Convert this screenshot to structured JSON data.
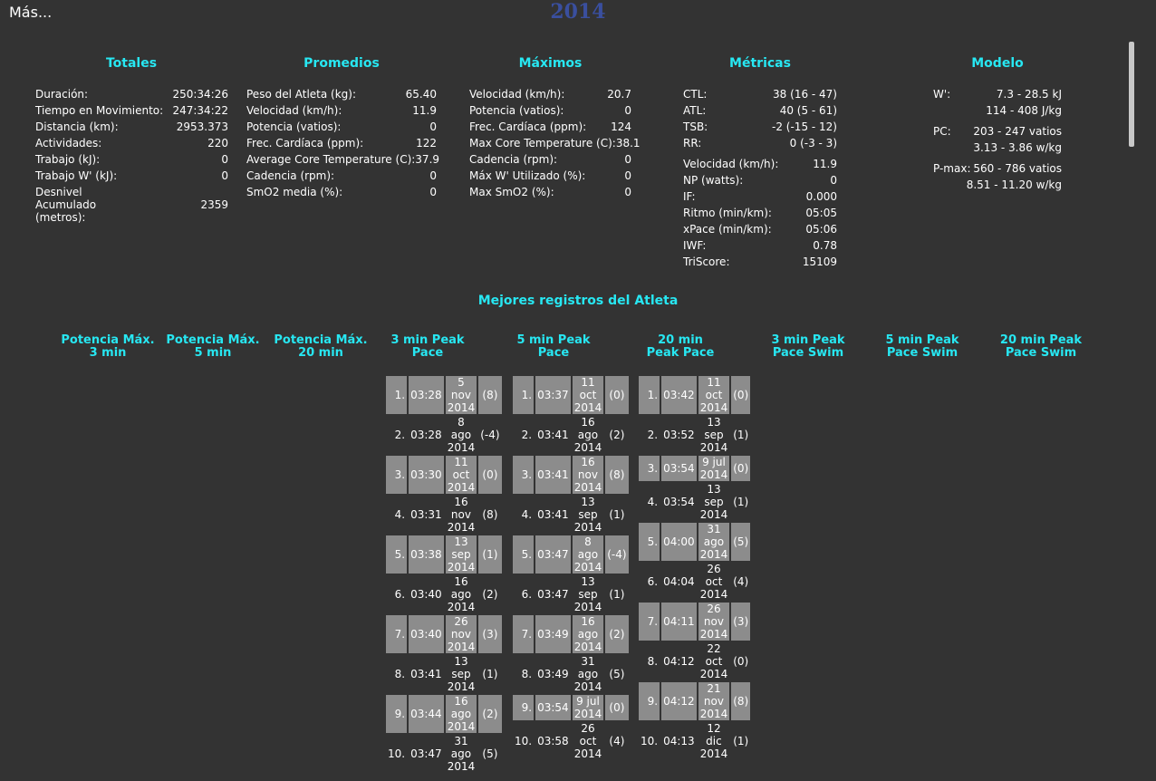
{
  "header": {
    "more_label": "Más...",
    "year": "2014"
  },
  "totales": {
    "title": "Totales",
    "rows": [
      {
        "label": "Duración:",
        "value": "250:34:26"
      },
      {
        "label": "Tiempo en Movimiento:",
        "value": "247:34:22"
      },
      {
        "label": "Distancia (km):",
        "value": "2953.373"
      },
      {
        "label": "Actividades:",
        "value": "220"
      },
      {
        "label": "Trabajo (kJ):",
        "value": "0"
      },
      {
        "label": "Trabajo W' (kJ):",
        "value": "0"
      },
      {
        "label": "Desnivel Acumulado (metros):",
        "value": "2359"
      }
    ]
  },
  "promedios": {
    "title": "Promedios",
    "rows": [
      {
        "label": "Peso del Atleta (kg):",
        "value": "65.40"
      },
      {
        "label": "Velocidad (km/h):",
        "value": "11.9"
      },
      {
        "label": "Potencia (vatios):",
        "value": "0"
      },
      {
        "label": "Frec. Cardíaca (ppm):",
        "value": "122"
      },
      {
        "label": "Average Core Temperature (C):",
        "value": "37.9"
      },
      {
        "label": "Cadencia (rpm):",
        "value": "0"
      },
      {
        "label": "SmO2 media (%):",
        "value": "0"
      }
    ]
  },
  "maximos": {
    "title": "Máximos",
    "rows": [
      {
        "label": "Velocidad (km/h):",
        "value": "20.7"
      },
      {
        "label": "Potencia (vatios):",
        "value": "0"
      },
      {
        "label": "Frec. Cardíaca (ppm):",
        "value": "124"
      },
      {
        "label": "Max Core Temperature (C):",
        "value": "38.1"
      },
      {
        "label": "Cadencia (rpm):",
        "value": "0"
      },
      {
        "label": "Máx W' Utilizado (%):",
        "value": "0"
      },
      {
        "label": "Max SmO2 (%):",
        "value": "0"
      }
    ]
  },
  "metricas": {
    "title": "Métricas",
    "group1": [
      {
        "label": "CTL:",
        "value": "38 (16 - 47)"
      },
      {
        "label": "ATL:",
        "value": "40 (5 - 61)"
      },
      {
        "label": "TSB:",
        "value": "-2 (-15 - 12)"
      },
      {
        "label": "RR:",
        "value": "0 (-3 - 3)"
      }
    ],
    "group2": [
      {
        "label": "Velocidad (km/h):",
        "value": "11.9"
      },
      {
        "label": "NP (watts):",
        "value": "0"
      },
      {
        "label": "IF:",
        "value": "0.000"
      },
      {
        "label": "Ritmo (min/km):",
        "value": "05:05"
      },
      {
        "label": "xPace (min/km):",
        "value": "05:06"
      },
      {
        "label": "IWF:",
        "value": "0.78"
      },
      {
        "label": "TriScore:",
        "value": "15109"
      }
    ]
  },
  "modelo": {
    "title": "Modelo",
    "rows": [
      {
        "label": "W':",
        "value1": "7.3 - 28.5 kJ",
        "value2": "114 - 408 J/kg"
      },
      {
        "label": "PC:",
        "value1": "203 - 247 vatios",
        "value2": "3.13 - 3.86 w/kg"
      },
      {
        "label": "P-max:",
        "value1": "560 - 786 vatios",
        "value2": "8.51 - 11.20 w/kg"
      }
    ]
  },
  "records": {
    "title": "Mejores registros del Atleta",
    "columns": [
      "Potencia Máx. 3 min",
      "Potencia Máx. 5 min",
      "Potencia Máx. 20 min",
      "3 min Peak Pace",
      "5 min Peak Pace",
      "20 min Peak Pace",
      "3 min Peak Pace Swim",
      "5 min Peak Pace Swim",
      "20 min Peak Pace Swim"
    ],
    "pace3": [
      {
        "rank": "1.",
        "time": "03:28",
        "date": "5 nov 2014",
        "delta": "(8)"
      },
      {
        "rank": "2.",
        "time": "03:28",
        "date": "8 ago 2014",
        "delta": "(-4)"
      },
      {
        "rank": "3.",
        "time": "03:30",
        "date": "11 oct 2014",
        "delta": "(0)"
      },
      {
        "rank": "4.",
        "time": "03:31",
        "date": "16 nov 2014",
        "delta": "(8)"
      },
      {
        "rank": "5.",
        "time": "03:38",
        "date": "13 sep 2014",
        "delta": "(1)"
      },
      {
        "rank": "6.",
        "time": "03:40",
        "date": "16 ago 2014",
        "delta": "(2)"
      },
      {
        "rank": "7.",
        "time": "03:40",
        "date": "26 nov 2014",
        "delta": "(3)"
      },
      {
        "rank": "8.",
        "time": "03:41",
        "date": "13 sep 2014",
        "delta": "(1)"
      },
      {
        "rank": "9.",
        "time": "03:44",
        "date": "16 ago 2014",
        "delta": "(2)"
      },
      {
        "rank": "10.",
        "time": "03:47",
        "date": "31 ago 2014",
        "delta": "(5)"
      }
    ],
    "pace5": [
      {
        "rank": "1.",
        "time": "03:37",
        "date": "11 oct 2014",
        "delta": "(0)"
      },
      {
        "rank": "2.",
        "time": "03:41",
        "date": "16 ago 2014",
        "delta": "(2)"
      },
      {
        "rank": "3.",
        "time": "03:41",
        "date": "16 nov 2014",
        "delta": "(8)"
      },
      {
        "rank": "4.",
        "time": "03:41",
        "date": "13 sep 2014",
        "delta": "(1)"
      },
      {
        "rank": "5.",
        "time": "03:47",
        "date": "8 ago 2014",
        "delta": "(-4)"
      },
      {
        "rank": "6.",
        "time": "03:47",
        "date": "13 sep 2014",
        "delta": "(1)"
      },
      {
        "rank": "7.",
        "time": "03:49",
        "date": "16 ago 2014",
        "delta": "(2)"
      },
      {
        "rank": "8.",
        "time": "03:49",
        "date": "31 ago 2014",
        "delta": "(5)"
      },
      {
        "rank": "9.",
        "time": "03:54",
        "date": "9 jul 2014",
        "delta": "(0)"
      },
      {
        "rank": "10.",
        "time": "03:58",
        "date": "26 oct 2014",
        "delta": "(4)"
      }
    ],
    "pace20": [
      {
        "rank": "1.",
        "time": "03:42",
        "date": "11 oct 2014",
        "delta": "(0)"
      },
      {
        "rank": "2.",
        "time": "03:52",
        "date": "13 sep 2014",
        "delta": "(1)"
      },
      {
        "rank": "3.",
        "time": "03:54",
        "date": "9 jul 2014",
        "delta": "(0)"
      },
      {
        "rank": "4.",
        "time": "03:54",
        "date": "13 sep 2014",
        "delta": "(1)"
      },
      {
        "rank": "5.",
        "time": "04:00",
        "date": "31 ago 2014",
        "delta": "(5)"
      },
      {
        "rank": "6.",
        "time": "04:04",
        "date": "26 oct 2014",
        "delta": "(4)"
      },
      {
        "rank": "7.",
        "time": "04:11",
        "date": "26 nov 2014",
        "delta": "(3)"
      },
      {
        "rank": "8.",
        "time": "04:12",
        "date": "22 oct 2014",
        "delta": "(0)"
      },
      {
        "rank": "9.",
        "time": "04:12",
        "date": "21 nov 2014",
        "delta": "(8)"
      },
      {
        "rank": "10.",
        "time": "04:13",
        "date": "12 dic 2014",
        "delta": "(1)"
      }
    ]
  }
}
